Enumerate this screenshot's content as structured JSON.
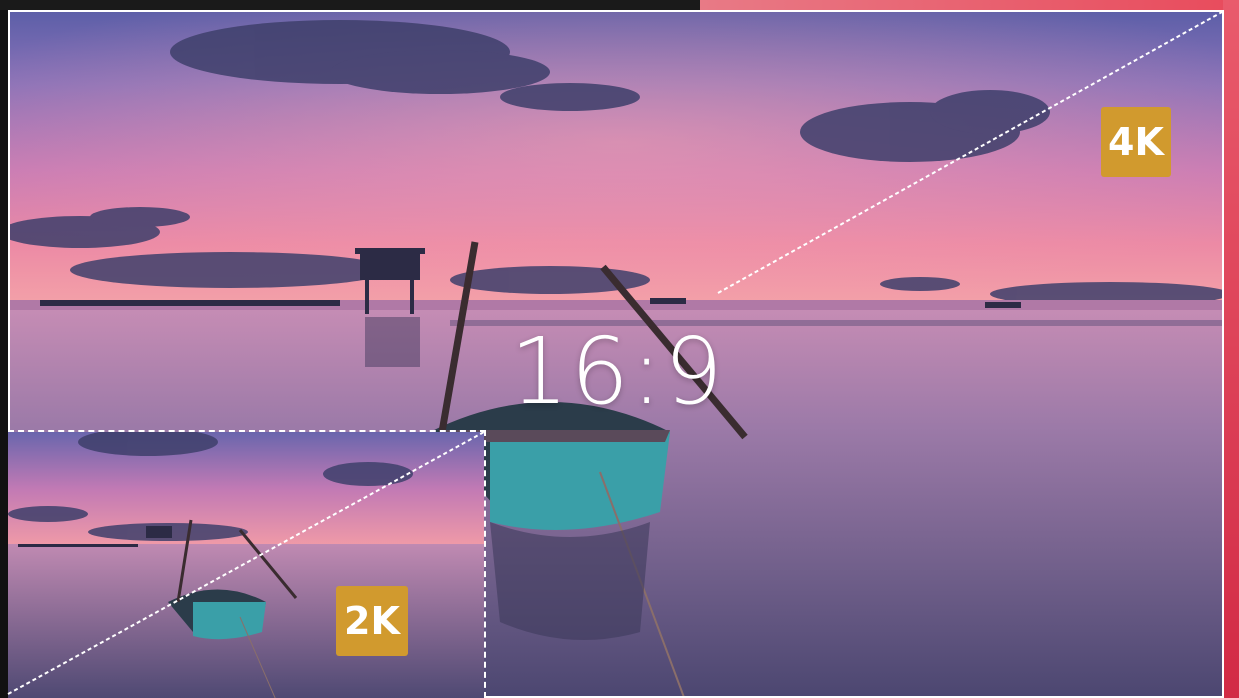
{
  "aspect_ratio_label": "16:9",
  "badges": {
    "large": "4K",
    "small": "2K"
  },
  "colors": {
    "badge": "#d19a2e",
    "frame": "#ffffff",
    "accent_edge": "#e84b5c"
  }
}
